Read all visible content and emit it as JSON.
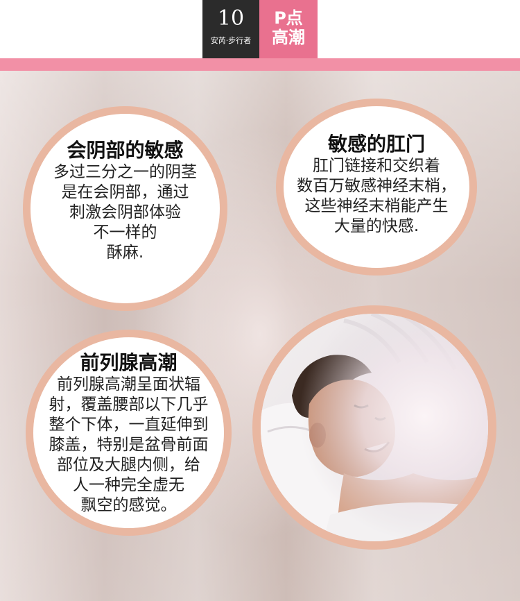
{
  "header": {
    "number": "10",
    "subtitle": "安芮·步行者",
    "tag_line1": "P点",
    "tag_line2": "高潮"
  },
  "circles": [
    {
      "title": "会阴部的敏感",
      "lines": [
        "多过三分之一的阴茎",
        "是在会阴部，通过",
        "刺激会阴部体验",
        "不一样的",
        "酥麻."
      ]
    },
    {
      "title": "敏感的肛门",
      "lines": [
        "肛门链接和交织着",
        "数百万敏感神经末梢，",
        "这些神经末梢能产生",
        "大量的快感."
      ]
    },
    {
      "title": "前列腺高潮",
      "lines": [
        "前列腺高潮呈面状辐",
        "射，覆盖腰部以下几乎",
        "整个下体，一直延伸到",
        "膝盖，特别是盆骨前面",
        "部位及大腿内侧，给",
        "人一种完全虚无",
        "飘空的感觉。"
      ]
    }
  ],
  "colors": {
    "accent_pink": "#e9718f",
    "stripe_pink": "#f290a6",
    "ring": "#e9b7a1",
    "dark": "#2b2b2b"
  }
}
